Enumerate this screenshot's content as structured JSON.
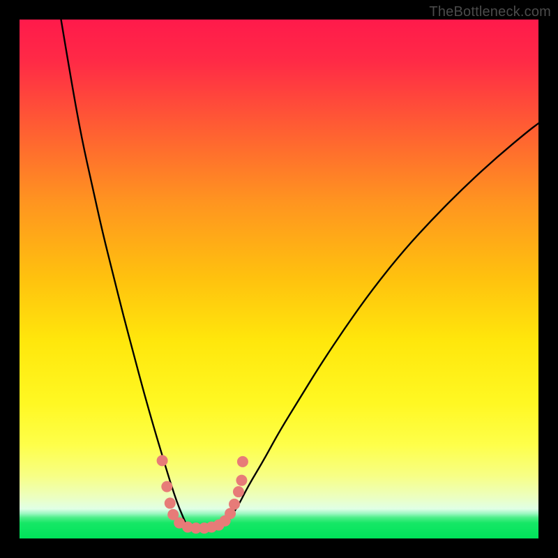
{
  "watermark": "TheBottleneck.com",
  "chart_data": {
    "type": "line",
    "title": "",
    "xlabel": "",
    "ylabel": "",
    "xlim": [
      0,
      100
    ],
    "ylim": [
      0,
      100
    ],
    "grid": false,
    "background_gradient": {
      "top_color": "#ff1e4c",
      "mid_color": "#ffe100",
      "green_band_color": "#00ee66",
      "green_band_y_range": [
        0,
        6
      ]
    },
    "series": [
      {
        "name": "bottleneck_curve_left",
        "stroke": "#000000",
        "x": [
          8,
          10,
          12,
          14,
          16,
          18,
          20,
          22,
          24,
          26,
          27.5,
          29,
          30.5,
          32
        ],
        "y": [
          100,
          88,
          77,
          68,
          59,
          51,
          43,
          35.5,
          28,
          21,
          16,
          11,
          6.5,
          3
        ]
      },
      {
        "name": "bottleneck_curve_right",
        "stroke": "#000000",
        "x": [
          40,
          42,
          44,
          47,
          50,
          54,
          58,
          63,
          68,
          74,
          80,
          86,
          92,
          98,
          100
        ],
        "y": [
          3,
          6,
          10,
          15,
          20.5,
          27,
          33.5,
          41,
          48,
          55.5,
          62,
          68,
          73.5,
          78.5,
          80
        ]
      }
    ],
    "markers": {
      "name": "highlight_points",
      "color": "#e77b78",
      "radius_px": 8,
      "points": [
        {
          "x": 27.5,
          "y": 15.0
        },
        {
          "x": 28.4,
          "y": 10.0
        },
        {
          "x": 29.0,
          "y": 6.8
        },
        {
          "x": 29.6,
          "y": 4.6
        },
        {
          "x": 30.8,
          "y": 3.0
        },
        {
          "x": 32.4,
          "y": 2.2
        },
        {
          "x": 34.0,
          "y": 2.0
        },
        {
          "x": 35.6,
          "y": 2.0
        },
        {
          "x": 37.0,
          "y": 2.2
        },
        {
          "x": 38.4,
          "y": 2.6
        },
        {
          "x": 39.6,
          "y": 3.4
        },
        {
          "x": 40.6,
          "y": 4.8
        },
        {
          "x": 41.4,
          "y": 6.6
        },
        {
          "x": 42.2,
          "y": 9.0
        },
        {
          "x": 42.8,
          "y": 11.2
        },
        {
          "x": 43.0,
          "y": 14.8
        }
      ]
    }
  }
}
